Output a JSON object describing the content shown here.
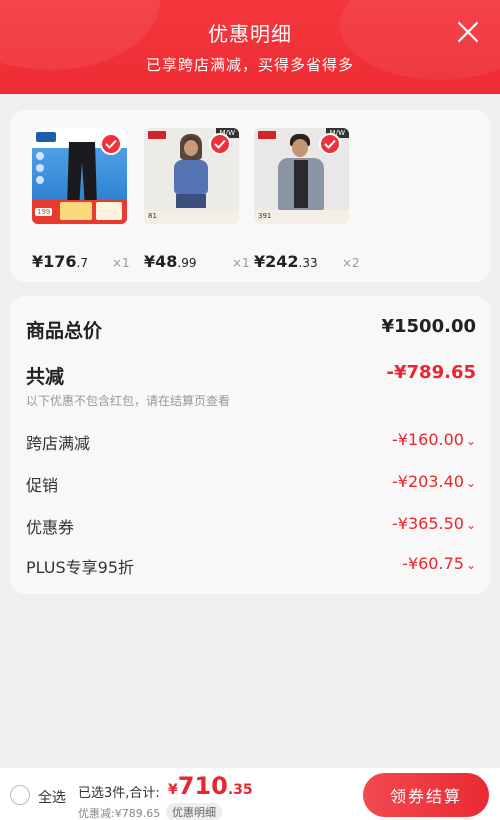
{
  "header": {
    "title": "优惠明细",
    "subtitle": "已享跨店满减，买得多省得多"
  },
  "products": [
    {
      "price_main": "¥176",
      "price_cents": ".7",
      "qty": "×1",
      "image": "black-trousers-product-image",
      "thumb_label": "199"
    },
    {
      "price_main": "¥48",
      "price_cents": ".99",
      "qty": "×1",
      "image": "woman-blue-tshirt-product-image",
      "thumb_label": "81"
    },
    {
      "price_main": "¥242",
      "price_cents": ".33",
      "qty": "×2",
      "image": "man-denim-jacket-product-image",
      "thumb_label": "391"
    }
  ],
  "summary": {
    "total_label": "商品总价",
    "total_value": "¥1500.00",
    "reduce_label": "共减",
    "reduce_value": "-¥789.65",
    "note": "以下优惠不包含红包，请在结算页查看",
    "items": [
      {
        "label": "跨店满减",
        "value": "-¥160.00"
      },
      {
        "label": "促销",
        "value": "-¥203.40"
      },
      {
        "label": "优惠券",
        "value": "-¥365.50"
      },
      {
        "label": "PLUS专享95折",
        "value": "-¥60.75"
      }
    ]
  },
  "bottom": {
    "select_all": "全选",
    "selected_text": "已选3件,合计:",
    "total_yen": "¥",
    "total_int": "710",
    "total_dec": ".35",
    "discount_text": "优惠减:¥789.65",
    "detail_tag": "优惠明细",
    "checkout": "领券结算"
  },
  "colors": {
    "accent": "#ee2b33",
    "price_red": "#e8262e"
  }
}
